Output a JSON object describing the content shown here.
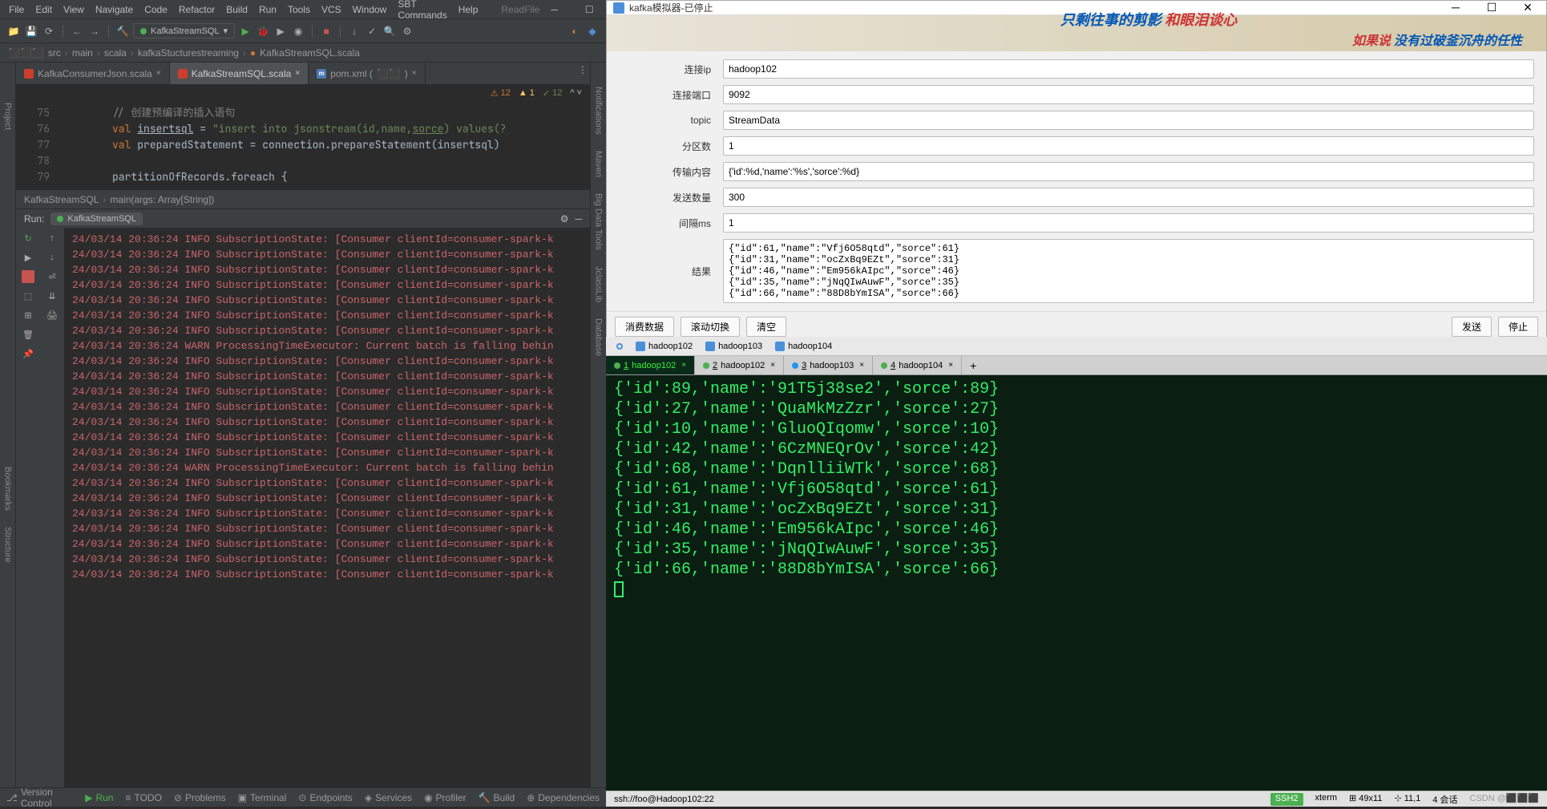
{
  "ide": {
    "menu": [
      "File",
      "Edit",
      "View",
      "Navigate",
      "Code",
      "Refactor",
      "Build",
      "Run",
      "Tools",
      "VCS",
      "Window",
      "SBT Commands",
      "Help"
    ],
    "readfile": "ReadFile",
    "run_config": "KafkaStreamSQL",
    "breadcrumb": [
      "src",
      "main",
      "scala",
      "kafkaStucturestreaming",
      "KafkaStreamSQL.scala"
    ],
    "tabs": [
      {
        "label": "KafkaConsumerJson.scala",
        "active": false,
        "icon": "scala"
      },
      {
        "label": "KafkaStreamSQL.scala",
        "active": true,
        "icon": "scala"
      },
      {
        "label": "pom.xml (",
        "active": false,
        "icon": "xml"
      }
    ],
    "inspections": {
      "errors": "12",
      "warnings": "1",
      "typos": "12"
    },
    "code": {
      "lines": [
        75,
        76,
        77,
        78,
        79
      ],
      "l75": "// 创建预编译的插入语句",
      "l76_kw": "val",
      "l76_id": "insertsql",
      "l76_str1": "\"insert into jsonstream(id,name,",
      "l76_u": "sorce",
      "l76_str2": ") values(?",
      "l77_kw": "val",
      "l77_id": "preparedStatement = connection.prepareStatement(insertsql)",
      "l79": "partitionOfRecords.foreach {"
    },
    "nav": {
      "class": "KafkaStreamSQL",
      "method": "main(args: Array[String])"
    },
    "run": {
      "label": "Run:",
      "tab": "KafkaStreamSQL",
      "lines": [
        "24/03/14 20:36:24 INFO SubscriptionState: [Consumer clientId=consumer-spark-k",
        "24/03/14 20:36:24 INFO SubscriptionState: [Consumer clientId=consumer-spark-k",
        "24/03/14 20:36:24 INFO SubscriptionState: [Consumer clientId=consumer-spark-k",
        "24/03/14 20:36:24 INFO SubscriptionState: [Consumer clientId=consumer-spark-k",
        "24/03/14 20:36:24 INFO SubscriptionState: [Consumer clientId=consumer-spark-k",
        "24/03/14 20:36:24 INFO SubscriptionState: [Consumer clientId=consumer-spark-k",
        "24/03/14 20:36:24 INFO SubscriptionState: [Consumer clientId=consumer-spark-k",
        "24/03/14 20:36:24 WARN ProcessingTimeExecutor: Current batch is falling behin",
        "24/03/14 20:36:24 INFO SubscriptionState: [Consumer clientId=consumer-spark-k",
        "24/03/14 20:36:24 INFO SubscriptionState: [Consumer clientId=consumer-spark-k",
        "24/03/14 20:36:24 INFO SubscriptionState: [Consumer clientId=consumer-spark-k",
        "24/03/14 20:36:24 INFO SubscriptionState: [Consumer clientId=consumer-spark-k",
        "24/03/14 20:36:24 INFO SubscriptionState: [Consumer clientId=consumer-spark-k",
        "24/03/14 20:36:24 INFO SubscriptionState: [Consumer clientId=consumer-spark-k",
        "24/03/14 20:36:24 INFO SubscriptionState: [Consumer clientId=consumer-spark-k",
        "24/03/14 20:36:24 WARN ProcessingTimeExecutor: Current batch is falling behin",
        "24/03/14 20:36:24 INFO SubscriptionState: [Consumer clientId=consumer-spark-k",
        "24/03/14 20:36:24 INFO SubscriptionState: [Consumer clientId=consumer-spark-k",
        "24/03/14 20:36:24 INFO SubscriptionState: [Consumer clientId=consumer-spark-k",
        "24/03/14 20:36:24 INFO SubscriptionState: [Consumer clientId=consumer-spark-k",
        "24/03/14 20:36:24 INFO SubscriptionState: [Consumer clientId=consumer-spark-k",
        "24/03/14 20:36:24 INFO SubscriptionState: [Consumer clientId=consumer-spark-k",
        "24/03/14 20:36:24 INFO SubscriptionState: [Consumer clientId=consumer-spark-k"
      ]
    },
    "statusbar": [
      "Version Control",
      "Run",
      "TODO",
      "Problems",
      "Terminal",
      "Endpoints",
      "Services",
      "Profiler",
      "Build",
      "Dependencies"
    ],
    "left_tools": [
      "Project",
      "Bookmarks",
      "Structure"
    ],
    "right_tools": [
      "Notifications",
      "Maven",
      "Big Data Tools",
      "JclassLib",
      "Database"
    ]
  },
  "kafka": {
    "title": "kafka模拟器-已停止",
    "banner1a": "只剩往事的剪影",
    "banner1b": " 和眼泪谈心",
    "banner2a": "如果说 ",
    "banner2b": "没有过破釜沉舟的任性",
    "labels": {
      "ip": "连接ip",
      "port": "连接端口",
      "topic": "topic",
      "partitions": "分区数",
      "content": "传输内容",
      "count": "发送数量",
      "interval": "间隔ms",
      "result": "结果"
    },
    "values": {
      "ip": "hadoop102",
      "port": "9092",
      "topic": "StreamData",
      "partitions": "1",
      "content": "{'id':%d,'name':'%s','sorce':%d}",
      "count": "300",
      "interval": "1"
    },
    "result": "{\"id\":61,\"name\":\"Vfj6O58qtd\",\"sorce\":61}\n{\"id\":31,\"name\":\"ocZxBq9EZt\",\"sorce\":31}\n{\"id\":46,\"name\":\"Em956kAIpc\",\"sorce\":46}\n{\"id\":35,\"name\":\"jNqQIwAuwF\",\"sorce\":35}\n{\"id\":66,\"name\":\"88D8bYmISA\",\"sorce\":66}",
    "buttons": {
      "consume": "消费数据",
      "scroll": "滚动切换",
      "clear": "清空",
      "send": "发送",
      "stop": "停止"
    }
  },
  "terminal": {
    "hosts": [
      "hadoop102",
      "hadoop103",
      "hadoop104"
    ],
    "tabs": [
      {
        "n": "1",
        "label": "hadoop102",
        "active": true,
        "dot": "green"
      },
      {
        "n": "2",
        "label": "hadoop102",
        "active": false,
        "dot": "green"
      },
      {
        "n": "3",
        "label": "hadoop103",
        "active": false,
        "dot": "blue"
      },
      {
        "n": "4",
        "label": "hadoop104",
        "active": false,
        "dot": "green"
      }
    ],
    "lines": [
      "{'id':89,'name':'91T5j38se2','sorce':89}",
      "{'id':27,'name':'QuaMkMzZzr','sorce':27}",
      "{'id':10,'name':'GluoQIqomw','sorce':10}",
      "{'id':42,'name':'6CzMNEQrOv','sorce':42}",
      "{'id':68,'name':'DqnlliiWTk','sorce':68}",
      "{'id':61,'name':'Vfj6O58qtd','sorce':61}",
      "{'id':31,'name':'ocZxBq9EZt','sorce':31}",
      "{'id':46,'name':'Em956kAIpc','sorce':46}",
      "{'id':35,'name':'jNqQIwAuwF','sorce':35}",
      "{'id':66,'name':'88D8bYmISA','sorce':66}"
    ],
    "status": {
      "conn": "ssh://foo@Hadoop102:22",
      "ssh": "SSH2",
      "term": "xterm",
      "size": "49x11",
      "pos": "11,1",
      "sessions": "4 会话"
    }
  }
}
